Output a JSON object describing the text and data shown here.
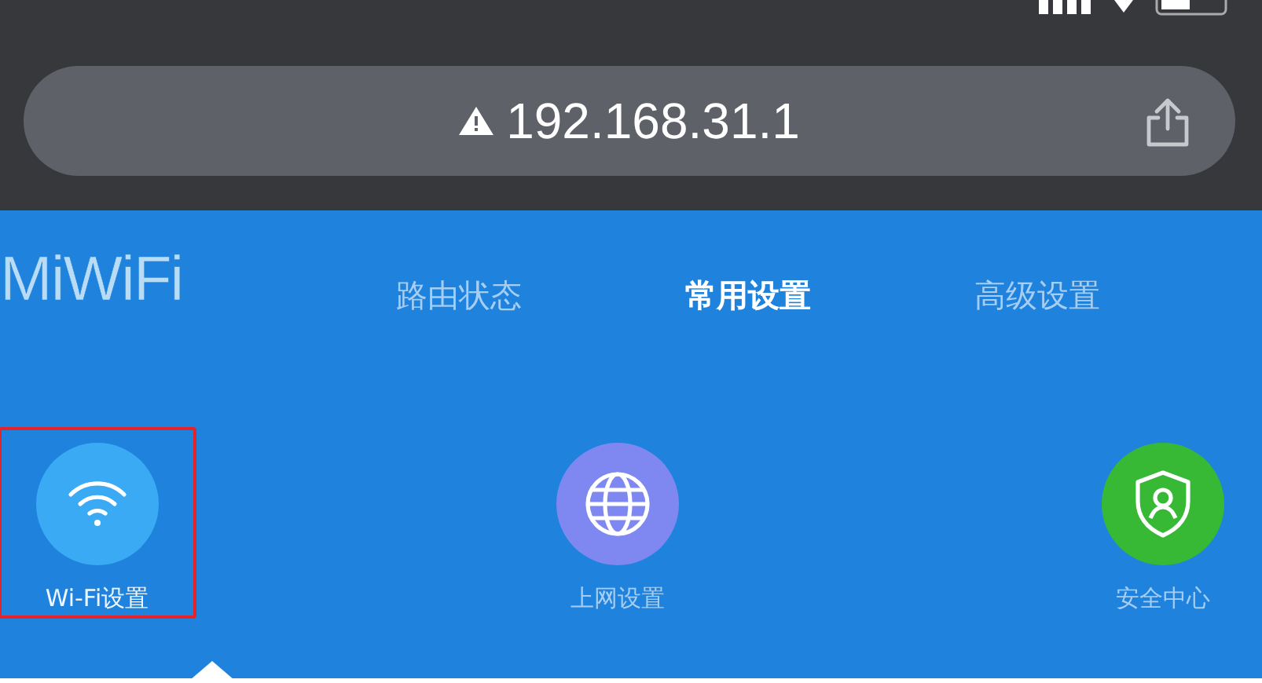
{
  "address_bar": {
    "url": "192.168.31.1",
    "secure": false
  },
  "logo": "MiWiFi",
  "tabs": [
    {
      "label": "路由状态",
      "selected": false
    },
    {
      "label": "常用设置",
      "selected": true
    },
    {
      "label": "高级设置",
      "selected": false
    }
  ],
  "settings": [
    {
      "kind": "wifi",
      "label": "Wi-Fi设置",
      "color": "#3aaaf5",
      "selected": true,
      "highlighted": true
    },
    {
      "kind": "internet",
      "label": "上网设置",
      "color": "#7e88f0",
      "selected": false,
      "highlighted": false
    },
    {
      "kind": "security",
      "label": "安全中心",
      "color": "#37b935",
      "selected": false,
      "highlighted": false
    }
  ]
}
